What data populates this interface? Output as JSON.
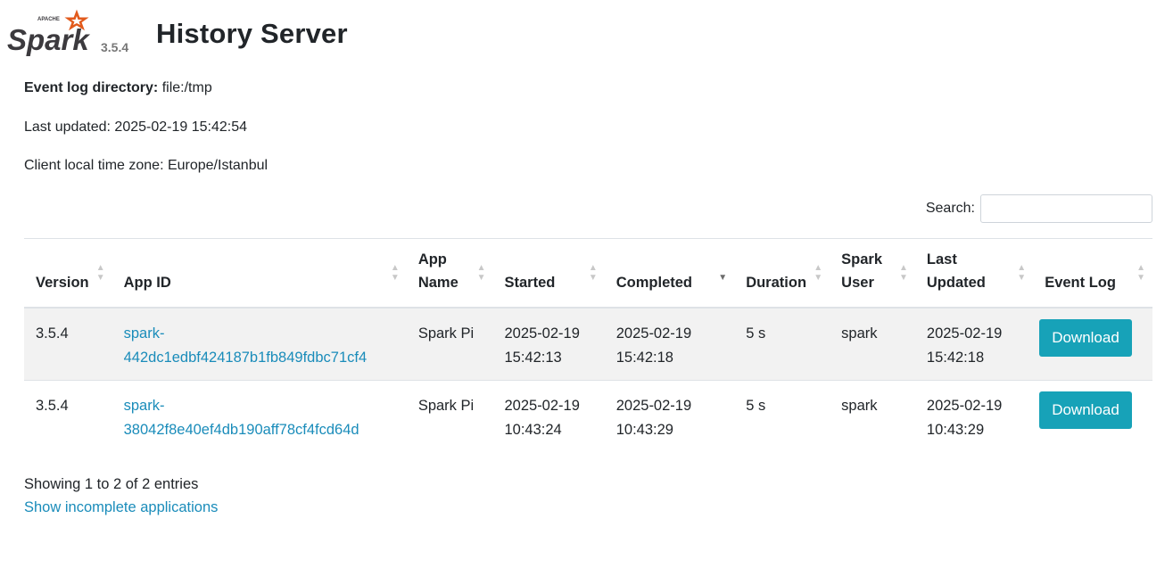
{
  "header": {
    "logo_text": "Spark",
    "logo_apache": "APACHE",
    "version": "3.5.4",
    "title": "History Server"
  },
  "info": {
    "event_log_label": "Event log directory:",
    "event_log_value": "file:/tmp",
    "last_updated": "Last updated: 2025-02-19 15:42:54",
    "timezone": "Client local time zone: Europe/Istanbul"
  },
  "search": {
    "label": "Search:",
    "value": "",
    "placeholder": ""
  },
  "table": {
    "headers": {
      "version": "Version",
      "app_id": "App ID",
      "app_name_1": "App",
      "app_name_2": "Name",
      "started": "Started",
      "completed": "Completed",
      "duration": "Duration",
      "spark_user_1": "Spark",
      "spark_user_2": "User",
      "last_updated_1": "Last",
      "last_updated_2": "Updated",
      "event_log": "Event Log"
    },
    "sorted_column": "completed",
    "sort_direction": "descending",
    "rows": [
      {
        "version": "3.5.4",
        "app_id_1": "spark-",
        "app_id_2": "442dc1edbf424187b1fb849fdbc71cf4",
        "app_name": "Spark Pi",
        "started_date": "2025-02-19",
        "started_time": "15:42:13",
        "completed_date": "2025-02-19",
        "completed_time": "15:42:18",
        "duration": "5 s",
        "user": "spark",
        "updated_date": "2025-02-19",
        "updated_time": "15:42:18",
        "download": "Download"
      },
      {
        "version": "3.5.4",
        "app_id_1": "spark-",
        "app_id_2": "38042f8e40ef4db190aff78cf4fcd64d",
        "app_name": "Spark Pi",
        "started_date": "2025-02-19",
        "started_time": "10:43:24",
        "completed_date": "2025-02-19",
        "completed_time": "10:43:29",
        "duration": "5 s",
        "user": "spark",
        "updated_date": "2025-02-19",
        "updated_time": "10:43:29",
        "download": "Download"
      }
    ]
  },
  "footer": {
    "showing": "Showing 1 to 2 of 2 entries",
    "incomplete_link": "Show incomplete applications"
  },
  "colors": {
    "accent_link": "#1a8cba",
    "button": "#17a2b8",
    "logo_orange": "#e25a1c",
    "logo_gray": "#3c3a3e"
  }
}
